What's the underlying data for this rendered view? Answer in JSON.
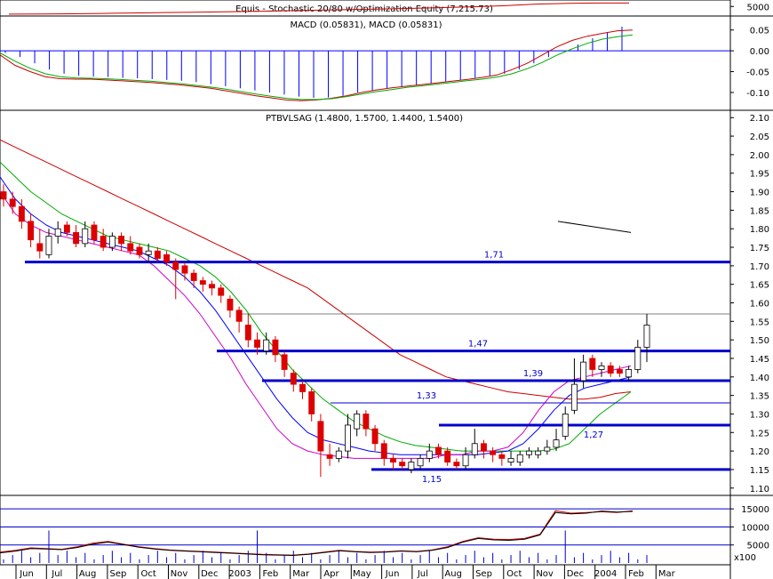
{
  "chart_data": [
    {
      "type": "line",
      "panel": "equity",
      "title": "Equis - Stochastic 20/80  w/Optimization Equity (7,215.73)",
      "yticks": [
        "5000"
      ],
      "ylim": [
        0,
        8000
      ],
      "series": [
        {
          "color": "#cc0000",
          "values": [
            50,
            120,
            300,
            500,
            800,
            1100,
            1300,
            1600,
            1900,
            2300,
            2600,
            3000,
            3400,
            3800,
            4300,
            4800,
            5500,
            6500,
            7000,
            7200,
            7215.73
          ]
        }
      ]
    },
    {
      "type": "line",
      "panel": "macd",
      "title": "MACD (0.05831), MACD (0.05831)",
      "yticks": [
        "0.05",
        "0.00",
        "-0.05",
        "-0.10"
      ],
      "ylim": [
        -0.13,
        0.075
      ],
      "series": [
        {
          "color": "#0000ff",
          "kind": "histogram",
          "values": [
            -0.005,
            -0.015,
            -0.03,
            -0.045,
            -0.055,
            -0.06,
            -0.062,
            -0.063,
            -0.065,
            -0.066,
            -0.068,
            -0.07,
            -0.072,
            -0.075,
            -0.08,
            -0.085,
            -0.09,
            -0.095,
            -0.1,
            -0.105,
            -0.11,
            -0.113,
            -0.112,
            -0.108,
            -0.1,
            -0.095,
            -0.09,
            -0.086,
            -0.082,
            -0.078,
            -0.074,
            -0.07,
            -0.065,
            -0.06,
            -0.055,
            -0.045,
            -0.03,
            -0.015,
            0.0,
            0.015,
            0.03,
            0.045,
            0.058
          ]
        },
        {
          "color": "#cc0000",
          "values": [
            -0.01,
            -0.035,
            -0.05,
            -0.062,
            -0.067,
            -0.068,
            -0.068,
            -0.07,
            -0.072,
            -0.074,
            -0.076,
            -0.079,
            -0.082,
            -0.086,
            -0.09,
            -0.096,
            -0.102,
            -0.108,
            -0.113,
            -0.118,
            -0.12,
            -0.118,
            -0.114,
            -0.108,
            -0.1,
            -0.094,
            -0.089,
            -0.085,
            -0.081,
            -0.077,
            -0.073,
            -0.069,
            -0.064,
            -0.058,
            -0.045,
            -0.03,
            -0.01,
            0.01,
            0.025,
            0.035,
            0.042,
            0.048,
            0.05
          ]
        },
        {
          "color": "#00aa00",
          "values": [
            -0.005,
            -0.025,
            -0.042,
            -0.055,
            -0.062,
            -0.065,
            -0.066,
            -0.067,
            -0.069,
            -0.071,
            -0.073,
            -0.076,
            -0.079,
            -0.083,
            -0.087,
            -0.092,
            -0.098,
            -0.104,
            -0.109,
            -0.114,
            -0.117,
            -0.117,
            -0.115,
            -0.11,
            -0.104,
            -0.098,
            -0.093,
            -0.088,
            -0.084,
            -0.08,
            -0.076,
            -0.072,
            -0.068,
            -0.063,
            -0.055,
            -0.043,
            -0.028,
            -0.01,
            0.005,
            0.018,
            0.028,
            0.034,
            0.038
          ]
        }
      ]
    },
    {
      "type": "candlestick",
      "panel": "price",
      "title": "PTBVLSAG (1.4800, 1.5700, 1.4400, 1.5400)",
      "yticks": [
        "2.10",
        "2.05",
        "2.00",
        "1.95",
        "1.90",
        "1.85",
        "1.80",
        "1.75",
        "1.70",
        "1.65",
        "1.60",
        "1.55",
        "1.50",
        "1.45",
        "1.40",
        "1.35",
        "1.30",
        "1.25",
        "1.20",
        "1.15",
        "1.10"
      ],
      "ylim": [
        1.085,
        2.115
      ],
      "levels": [
        {
          "label": "1,71",
          "value": 1.71
        },
        {
          "label": "1,47",
          "value": 1.47
        },
        {
          "label": "1,39",
          "value": 1.39
        },
        {
          "label": "1,33",
          "value": 1.33
        },
        {
          "label": "1,27",
          "value": 1.27
        },
        {
          "label": "1,15",
          "value": 1.15
        }
      ],
      "close": [
        1.88,
        1.86,
        1.82,
        1.77,
        1.74,
        1.78,
        1.8,
        1.79,
        1.76,
        1.8,
        1.77,
        1.75,
        1.78,
        1.76,
        1.74,
        1.73,
        1.74,
        1.72,
        1.71,
        1.69,
        1.68,
        1.66,
        1.65,
        1.64,
        1.62,
        1.58,
        1.55,
        1.5,
        1.48,
        1.5,
        1.46,
        1.42,
        1.38,
        1.36,
        1.3,
        1.2,
        1.18,
        1.2,
        1.27,
        1.3,
        1.26,
        1.22,
        1.18,
        1.17,
        1.16,
        1.17,
        1.18,
        1.2,
        1.19,
        1.17,
        1.16,
        1.19,
        1.22,
        1.2,
        1.19,
        1.18,
        1.18,
        1.19,
        1.2,
        1.2,
        1.21,
        1.23,
        1.3,
        1.38,
        1.44,
        1.42,
        1.43,
        1.41,
        1.41,
        1.42,
        1.48,
        1.54
      ],
      "open": [
        1.9,
        1.88,
        1.86,
        1.82,
        1.76,
        1.73,
        1.78,
        1.81,
        1.79,
        1.76,
        1.81,
        1.78,
        1.75,
        1.78,
        1.76,
        1.75,
        1.73,
        1.74,
        1.73,
        1.71,
        1.7,
        1.68,
        1.66,
        1.65,
        1.64,
        1.61,
        1.58,
        1.54,
        1.5,
        1.47,
        1.5,
        1.46,
        1.41,
        1.38,
        1.36,
        1.28,
        1.19,
        1.18,
        1.2,
        1.26,
        1.3,
        1.26,
        1.22,
        1.18,
        1.17,
        1.15,
        1.16,
        1.18,
        1.21,
        1.2,
        1.17,
        1.16,
        1.19,
        1.22,
        1.2,
        1.19,
        1.17,
        1.17,
        1.19,
        1.19,
        1.2,
        1.21,
        1.24,
        1.31,
        1.39,
        1.45,
        1.42,
        1.43,
        1.42,
        1.4,
        1.42,
        1.48
      ],
      "high": [
        1.92,
        1.9,
        1.88,
        1.84,
        1.8,
        1.8,
        1.82,
        1.82,
        1.81,
        1.82,
        1.82,
        1.8,
        1.79,
        1.79,
        1.78,
        1.76,
        1.76,
        1.75,
        1.74,
        1.72,
        1.71,
        1.69,
        1.67,
        1.66,
        1.65,
        1.62,
        1.59,
        1.57,
        1.52,
        1.52,
        1.51,
        1.47,
        1.42,
        1.39,
        1.37,
        1.3,
        1.22,
        1.21,
        1.3,
        1.31,
        1.31,
        1.27,
        1.23,
        1.19,
        1.18,
        1.18,
        1.19,
        1.22,
        1.22,
        1.21,
        1.18,
        1.21,
        1.26,
        1.23,
        1.21,
        1.2,
        1.2,
        1.2,
        1.21,
        1.21,
        1.23,
        1.26,
        1.32,
        1.45,
        1.46,
        1.46,
        1.44,
        1.44,
        1.43,
        1.43,
        1.5,
        1.57
      ],
      "low": [
        1.86,
        1.84,
        1.8,
        1.75,
        1.72,
        1.72,
        1.76,
        1.78,
        1.75,
        1.75,
        1.76,
        1.74,
        1.74,
        1.74,
        1.73,
        1.72,
        1.71,
        1.71,
        1.7,
        1.61,
        1.66,
        1.64,
        1.63,
        1.62,
        1.6,
        1.56,
        1.52,
        1.48,
        1.46,
        1.46,
        1.44,
        1.4,
        1.36,
        1.34,
        1.28,
        1.13,
        1.16,
        1.17,
        1.18,
        1.24,
        1.24,
        1.2,
        1.16,
        1.15,
        1.15,
        1.14,
        1.15,
        1.17,
        1.18,
        1.16,
        1.15,
        1.15,
        1.18,
        1.18,
        1.17,
        1.16,
        1.16,
        1.16,
        1.18,
        1.18,
        1.19,
        1.2,
        1.23,
        1.3,
        1.37,
        1.4,
        1.4,
        1.4,
        1.4,
        1.39,
        1.41,
        1.44
      ],
      "moving_averages": [
        {
          "color": "#cc0000",
          "values": [
            2.04,
            2.02,
            2.0,
            1.98,
            1.96,
            1.94,
            1.92,
            1.9,
            1.88,
            1.86,
            1.84,
            1.82,
            1.8,
            1.78,
            1.76,
            1.74,
            1.72,
            1.7,
            1.68,
            1.66,
            1.64,
            1.61,
            1.58,
            1.55,
            1.52,
            1.49,
            1.46,
            1.44,
            1.42,
            1.4,
            1.39,
            1.38,
            1.37,
            1.36,
            1.355,
            1.35,
            1.345,
            1.34,
            1.34,
            1.345,
            1.355,
            1.36
          ]
        },
        {
          "color": "#00aa00",
          "values": [
            1.98,
            1.94,
            1.9,
            1.87,
            1.84,
            1.82,
            1.8,
            1.78,
            1.77,
            1.76,
            1.75,
            1.74,
            1.72,
            1.7,
            1.67,
            1.63,
            1.58,
            1.52,
            1.47,
            1.42,
            1.38,
            1.34,
            1.31,
            1.28,
            1.26,
            1.24,
            1.225,
            1.215,
            1.21,
            1.205,
            1.2,
            1.2,
            1.2,
            1.2,
            1.2,
            1.2,
            1.205,
            1.22,
            1.26,
            1.3,
            1.33,
            1.36
          ]
        },
        {
          "color": "#0000ff",
          "values": [
            1.94,
            1.88,
            1.84,
            1.81,
            1.79,
            1.78,
            1.77,
            1.76,
            1.75,
            1.74,
            1.72,
            1.7,
            1.67,
            1.63,
            1.58,
            1.52,
            1.46,
            1.4,
            1.34,
            1.29,
            1.25,
            1.23,
            1.22,
            1.21,
            1.2,
            1.195,
            1.19,
            1.19,
            1.19,
            1.19,
            1.19,
            1.19,
            1.195,
            1.2,
            1.22,
            1.26,
            1.31,
            1.35,
            1.37,
            1.38,
            1.39,
            1.4
          ]
        },
        {
          "color": "#cc00cc",
          "values": [
            1.9,
            1.84,
            1.81,
            1.79,
            1.78,
            1.77,
            1.76,
            1.75,
            1.74,
            1.73,
            1.7,
            1.66,
            1.62,
            1.57,
            1.51,
            1.45,
            1.38,
            1.32,
            1.26,
            1.22,
            1.2,
            1.19,
            1.185,
            1.18,
            1.18,
            1.18,
            1.18,
            1.18,
            1.18,
            1.19,
            1.19,
            1.2,
            1.2,
            1.21,
            1.25,
            1.31,
            1.36,
            1.39,
            1.4,
            1.41,
            1.42,
            1.43
          ]
        }
      ],
      "trend_line": {
        "color": "#000000",
        "values": [
          1.82,
          1.79
        ]
      }
    },
    {
      "type": "line",
      "panel": "volume",
      "yticks": [
        "15000",
        "10000",
        "5000"
      ],
      "ylim": [
        0,
        18000
      ],
      "unit_label": "x100",
      "series": [
        {
          "color": "#cc0000",
          "values": [
            3000,
            3500,
            4200,
            4000,
            3800,
            4500,
            5500,
            6000,
            5200,
            4500,
            4000,
            3600,
            3400,
            3200,
            3000,
            2800,
            2600,
            2400,
            2300,
            2200,
            2500,
            3000,
            3500,
            3200,
            3000,
            3100,
            3400,
            3200,
            3600,
            4500,
            6000,
            7000,
            6600,
            6500,
            6800,
            8000,
            14500,
            13800,
            14000,
            14200,
            14000,
            14500
          ]
        },
        {
          "color": "#000000",
          "values": [
            2800,
            3300,
            4000,
            3900,
            3700,
            4300,
            5200,
            5800,
            5100,
            4400,
            3900,
            3500,
            3300,
            3100,
            2900,
            2700,
            2500,
            2300,
            2200,
            2100,
            2400,
            2900,
            3400,
            3100,
            2900,
            3000,
            3300,
            3100,
            3500,
            4300,
            5800,
            6800,
            6400,
            6300,
            6600,
            7800,
            14000,
            13600,
            13800,
            14400,
            14100,
            14300
          ]
        }
      ]
    }
  ],
  "x_axis": {
    "labels": [
      "Jun",
      "Jul",
      "Aug",
      "Sep",
      "Oct",
      "Nov",
      "Dec",
      "2003",
      "Feb",
      "Mar",
      "Apr",
      "May",
      "Jun",
      "Jul",
      "Aug",
      "Sep",
      "Oct",
      "Nov",
      "Dec",
      "2004",
      "Feb",
      "Mar"
    ]
  },
  "colors": {
    "up_candle": "#ffffff",
    "down_candle": "#dd0000",
    "level_line": "#0000cc",
    "frame": "#000000"
  }
}
